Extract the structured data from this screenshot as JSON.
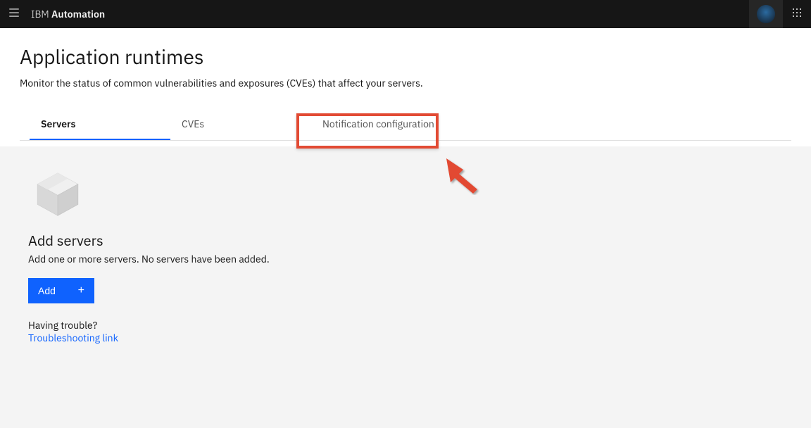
{
  "header": {
    "brand_light": "IBM ",
    "brand_bold": "Automation"
  },
  "page": {
    "title": "Application runtimes",
    "description": "Monitor the status of common vulnerabilities and exposures (CVEs) that affect your servers."
  },
  "tabs": {
    "servers": "Servers",
    "cves": "CVEs",
    "notification": "Notification configuration"
  },
  "empty_state": {
    "title": "Add servers",
    "description": "Add one or more servers. No servers have been added.",
    "add_label": "Add",
    "trouble_label": "Having trouble?",
    "trouble_link": "Troubleshooting link"
  }
}
